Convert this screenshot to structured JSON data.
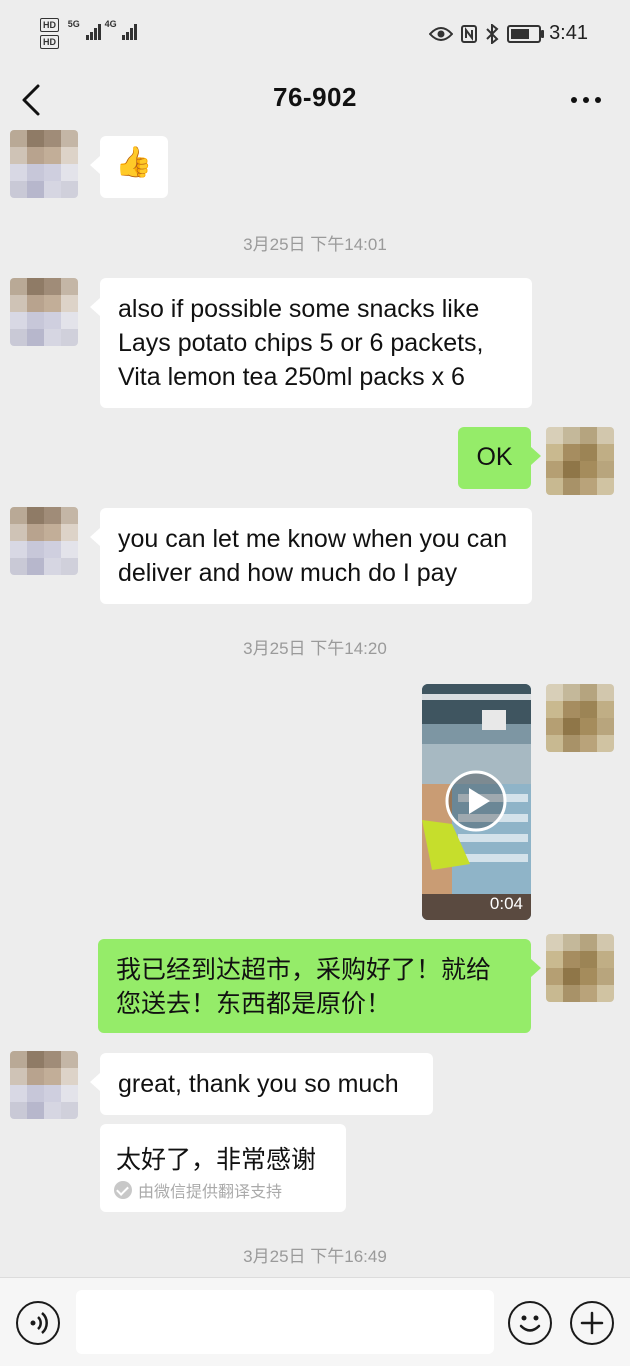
{
  "status_bar": {
    "hd1": "HD",
    "hd2": "HD",
    "net1": "5G",
    "net2": "4G",
    "time": "3:41"
  },
  "header": {
    "title": "76-902"
  },
  "messages": {
    "m1_emoji": "👍",
    "ts1": "3月25日 下午14:01",
    "m2_text": "also if possible some snacks like Lays potato chips 5 or 6 packets, Vita lemon tea 250ml packs x 6",
    "m3_text": "OK",
    "m4_text": "you can let me know when you can deliver and how much do I pay",
    "ts2": "3月25日 下午14:20",
    "video_duration": "0:04",
    "m6_text": "我已经到达超市，采购好了！就给您送去！东西都是原价！",
    "m7_text": "great, thank you so much",
    "m7_translation": "太好了，非常感谢",
    "translation_note": "由微信提供翻译支持",
    "ts3": "3月25日 下午16:49"
  },
  "colors": {
    "background": "#ededed",
    "sent_bubble": "#95ec69",
    "received_bubble": "#ffffff"
  },
  "battery_level": 0.7
}
